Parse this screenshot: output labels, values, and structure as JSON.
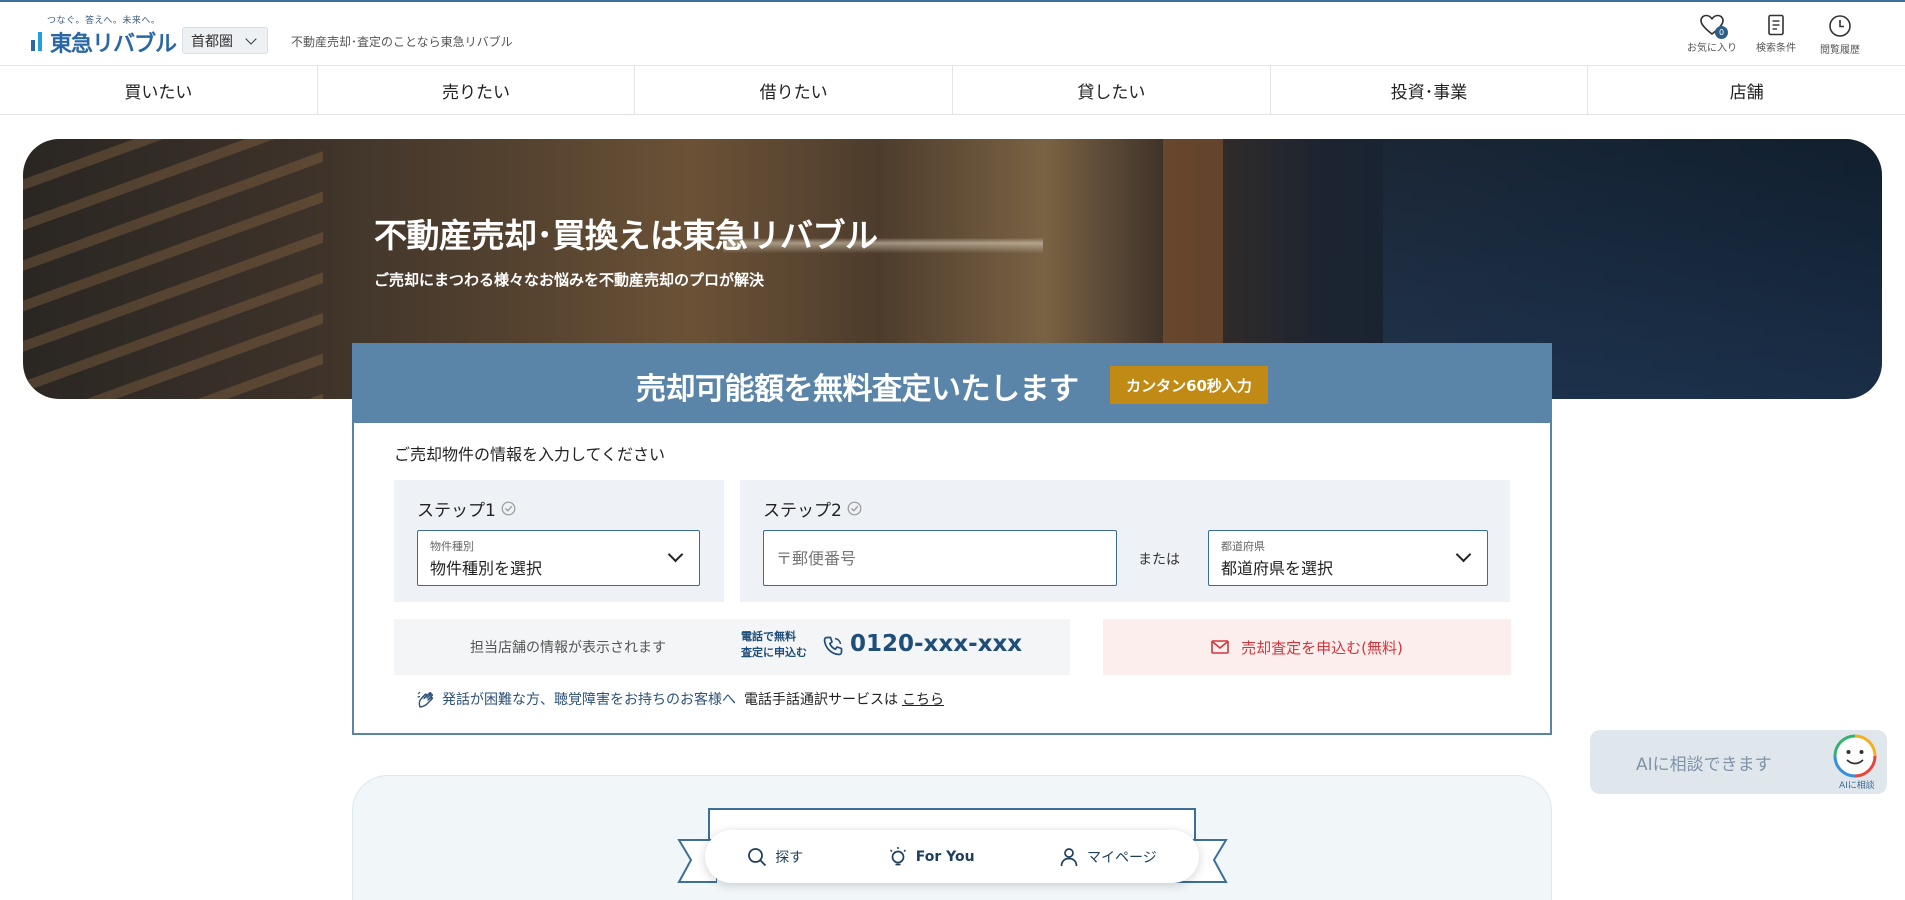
{
  "header": {
    "logo_tagline": "つなぐ。答えへ。未来へ。",
    "logo_text": "東急リバブル",
    "area_select": "首都圏",
    "description": "不動産売却･査定のことなら東急リバブル",
    "icons": [
      {
        "name": "favorites",
        "label": "お気に入り",
        "badge": "0"
      },
      {
        "name": "search-conditions",
        "label": "検索条件"
      },
      {
        "name": "history",
        "label": "閲覧履歴"
      }
    ]
  },
  "nav": {
    "items": [
      "買いたい",
      "売りたい",
      "借りたい",
      "貸したい",
      "投資･事業",
      "店舗"
    ]
  },
  "hero": {
    "title": "不動産売却･買換えは東急リバブル",
    "subtitle": "ご売却にまつわる様々なお悩みを不動産売却のプロが解決"
  },
  "appraisal": {
    "title": "売却可能額を無料査定いたします",
    "badge": "カンタン60秒入力",
    "lead": "ご売却物件の情報を入力してください",
    "step1": {
      "label": "ステップ1",
      "field_label": "物件種別",
      "field_value": "物件種別を選択"
    },
    "step2": {
      "label": "ステップ2",
      "zip_placeholder": "〒郵便番号",
      "or_text": "または",
      "pref_label": "都道府県",
      "pref_value": "都道府県を選択"
    },
    "store_text": "担当店舗の情報が表示されます",
    "tel_note_1": "電話で無料",
    "tel_note_2": "査定に申込む",
    "tel_number": "0120-xxx-xxx",
    "apply_button": "売却査定を申込む(無料)",
    "sign_text": "発話が困難な方、聴覚障害をお持ちのお客様へ",
    "sign_service": "電話手話通訳サービスは",
    "sign_link": "こちら"
  },
  "bottom_bar": {
    "search": "探す",
    "for_you": "For You",
    "mypage": "マイページ"
  },
  "ai_widget": {
    "text": "AIに相談できます",
    "label": "AIに相談"
  },
  "colors": {
    "brand_blue": "#2a67a6",
    "card_header": "#5a84a8",
    "badge_gold": "#c08a15",
    "apply_red": "#d2363d",
    "tel_navy": "#1f4e79"
  }
}
